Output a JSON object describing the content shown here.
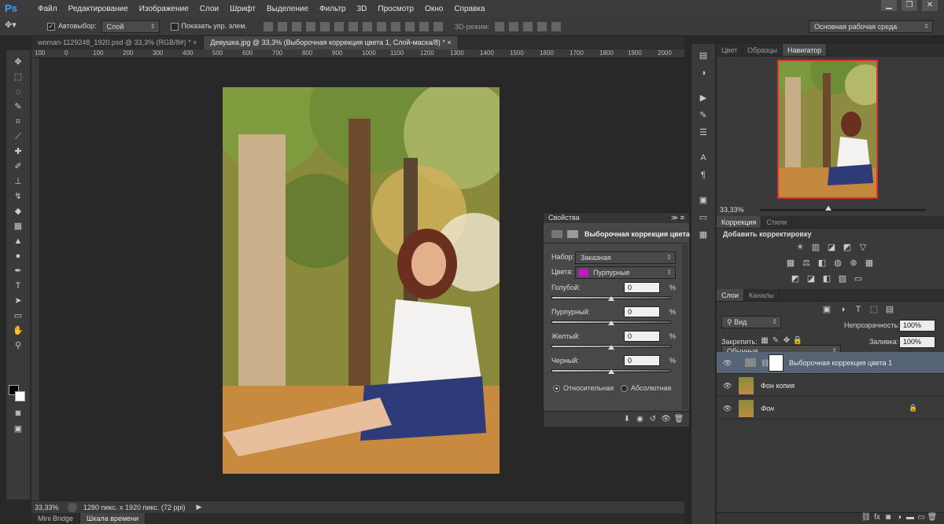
{
  "app": {
    "logo": "Ps",
    "menu": [
      "Файл",
      "Редактирование",
      "Изображение",
      "Слои",
      "Шрифт",
      "Выделение",
      "Фильтр",
      "3D",
      "Просмотр",
      "Окно",
      "Справка"
    ],
    "window_controls": [
      "▁",
      "❐",
      "✕"
    ]
  },
  "options": {
    "autoselect_label": "Автовыбор:",
    "autoselect_value": "Слой",
    "show_controls_label": "Показать упр. элем.",
    "mode3d_label": "3D-режим:",
    "workspace_value": "Основная рабочая среда"
  },
  "tabs": [
    {
      "label": "woman-1129248_1920.psd @ 33,3% (RGB/8#) *",
      "close": "×"
    },
    {
      "label": "Девушка.jpg @ 33,3% (Выборочная коррекция цвета 1, Слой-маска/8) *",
      "close": "×"
    }
  ],
  "ruler": [
    "100",
    "0",
    "100",
    "200",
    "300",
    "400",
    "500",
    "600",
    "700",
    "800",
    "900",
    "1000",
    "1100",
    "1200",
    "1300",
    "1400",
    "1500",
    "1600",
    "1700",
    "1800",
    "1900",
    "2000"
  ],
  "status": {
    "zoom": "33,33%",
    "doc_info": "1280 пикс. x 1920 пикс. (72 ppi)"
  },
  "bottom_tabs": [
    "Mini Bridge",
    "Шкала времени"
  ],
  "panels": {
    "top_tabs": [
      "Цвет",
      "Образцы",
      "Навигатор"
    ],
    "nav_zoom": "33,33%",
    "adj_tabs": [
      "Коррекция",
      "Стили"
    ],
    "adj_title": "Добавить корректировку",
    "layers_tabs": [
      "Слои",
      "Каналы"
    ],
    "kind_value": "Вид",
    "blend_mode": "Обычные",
    "opacity_label": "Непрозрачность:",
    "opacity_value": "100%",
    "lock_label": "Закрепить:",
    "fill_label": "Заливка:",
    "fill_value": "100%",
    "layers": [
      {
        "name": "Выборочная коррекция цвета 1"
      },
      {
        "name": "Фон копия"
      },
      {
        "name": "Фон"
      }
    ]
  },
  "properties": {
    "tab": "Свойства",
    "title": "Выборочная коррекция цвета",
    "preset_label": "Набор:",
    "preset_value": "Заказная",
    "colors_label": "Цвета:",
    "colors_value": "Пурпурные",
    "colors_swatch": "#c218c0",
    "sliders": [
      {
        "label": "Голубой:",
        "value": "0",
        "unit": "%"
      },
      {
        "label": "Пурпурный:",
        "value": "0",
        "unit": "%"
      },
      {
        "label": "Желтый:",
        "value": "0",
        "unit": "%"
      },
      {
        "label": "Черный:",
        "value": "0",
        "unit": "%"
      }
    ],
    "mode_relative": "Относительная",
    "mode_absolute": "Абсолютная"
  }
}
